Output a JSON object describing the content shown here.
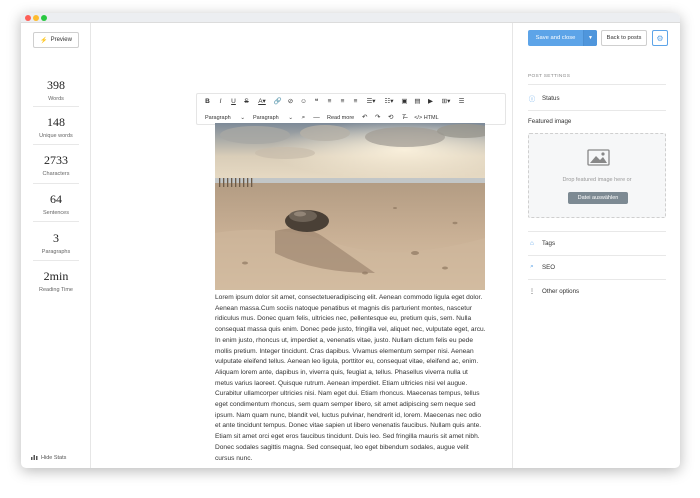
{
  "sidebar": {
    "preview_label": "Preview",
    "stats": [
      {
        "value": "398",
        "label": "Words"
      },
      {
        "value": "148",
        "label": "Unique words"
      },
      {
        "value": "2733",
        "label": "Characters"
      },
      {
        "value": "64",
        "label": "Sentences"
      },
      {
        "value": "3",
        "label": "Paragraphs"
      },
      {
        "value": "2min",
        "label": "Reading Time"
      }
    ],
    "hide_stats_label": "Hide Stats"
  },
  "toolbar": {
    "row1": [
      "bold-icon",
      "italic-icon",
      "underline-icon",
      "strikethrough-icon",
      "text-color-icon",
      "link-icon",
      "unlink-icon",
      "emoji-icon",
      "quote-icon",
      "align-left-icon",
      "align-center-icon",
      "align-right-icon",
      "bullet-list-icon",
      "numbered-list-icon",
      "image-icon",
      "gallery-icon",
      "video-icon",
      "table-icon",
      "more-icon"
    ],
    "select1": "Paragraph",
    "select2": "Paragraph",
    "read_more": "Read more",
    "html_label": "HTML"
  },
  "article": {
    "body": "Lorem ipsum dolor sit amet, consectetueradipiscing elit. Aenean commodo ligula eget dolor. Aenean massa.Cum sociis natoque penatibus et magnis dis parturient montes, nascetur ridiculus mus. Donec quam felis, ultricies nec, pellentesque eu, pretium quis, sem. Nulla consequat massa quis enim. Donec pede justo, fringilla vel, aliquet nec, vulputate eget, arcu. In enim justo, rhoncus ut, imperdiet a, venenatis vitae, justo. Nullam dictum felis eu pede mollis pretium. Integer tincidunt. Cras dapibus. Vivamus elementum semper nisi. Aenean vulputate eleifend tellus. Aenean leo ligula, porttitor eu, consequat vitae, eleifend ac, enim. Aliquam lorem ante, dapibus in, viverra quis, feugiat a, tellus. Phasellus viverra nulla ut metus varius laoreet. Quisque rutrum. Aenean imperdiet. Etiam ultricies nisi vel augue. Curabitur ullamcorper ultricies nisi. Nam eget dui. Etiam rhoncus. Maecenas tempus, tellus eget condimentum rhoncus, sem quam semper libero, sit amet adipiscing sem neque sed ipsum. Nam quam nunc, blandit vel, luctus pulvinar, hendrerit id, lorem. Maecenas nec odio et ante tincidunt tempus. Donec vitae sapien ut libero venenatis faucibus. Nullam quis ante. Etiam sit amet orci eget eros faucibus tincidunt. Duis leo. Sed fringilla mauris sit amet nibh. Donec sodales sagittis magna. Sed consequat, leo eget bibendum sodales, augue velit cursus nunc."
  },
  "right_panel": {
    "save_label": "Save and close",
    "back_label": "Back to posts",
    "post_settings": "POST SETTINGS",
    "status_label": "Status",
    "featured_image_label": "Featured image",
    "dropzone_text": "Drop featured image here or",
    "dropzone_button": "Datei auswählen",
    "tags_label": "Tags",
    "seo_label": "SEO",
    "other_options_label": "Other options",
    "accent": "#5da4e8"
  }
}
